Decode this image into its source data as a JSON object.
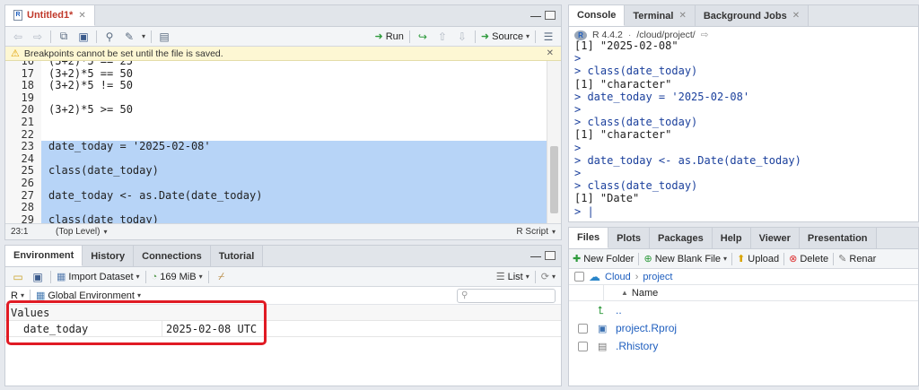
{
  "editor": {
    "tab_title": "Untitled1*",
    "toolbar": {
      "run_label": "Run",
      "source_label": "Source"
    },
    "warning": "Breakpoints cannot be set until the file is saved.",
    "lines": [
      {
        "num": "16",
        "code": "(3+2)*5 == 25",
        "highlight": false
      },
      {
        "num": "17",
        "code": "(3+2)*5 == 50",
        "highlight": false
      },
      {
        "num": "18",
        "code": "(3+2)*5 != 50",
        "highlight": false
      },
      {
        "num": "19",
        "code": "",
        "highlight": false
      },
      {
        "num": "20",
        "code": "(3+2)*5 >= 50",
        "highlight": false
      },
      {
        "num": "21",
        "code": "",
        "highlight": false
      },
      {
        "num": "22",
        "code": "",
        "highlight": false
      },
      {
        "num": "23",
        "code": "date_today = '2025-02-08'",
        "highlight": true
      },
      {
        "num": "24",
        "code": "",
        "highlight": true
      },
      {
        "num": "25",
        "code": "class(date_today)",
        "highlight": true
      },
      {
        "num": "26",
        "code": "",
        "highlight": true
      },
      {
        "num": "27",
        "code": "date_today <- as.Date(date_today)",
        "highlight": true
      },
      {
        "num": "28",
        "code": "",
        "highlight": true
      },
      {
        "num": "29",
        "code": "class(date_today)",
        "highlight": true
      }
    ],
    "status": {
      "position": "23:1",
      "scope": "(Top Level)",
      "filetype": "R Script"
    }
  },
  "env": {
    "tabs": [
      "Environment",
      "History",
      "Connections",
      "Tutorial"
    ],
    "import_label": "Import Dataset",
    "memory": "169 MiB",
    "list_label": "List",
    "lang": "R",
    "scope": "Global Environment",
    "section": "Values",
    "rows": [
      {
        "name": "date_today",
        "value": "2025-02-08 UTC"
      }
    ]
  },
  "console": {
    "tabs": [
      "Console",
      "Terminal",
      "Background Jobs"
    ],
    "version": "R 4.4.2",
    "path": "/cloud/project/",
    "lines": [
      {
        "type": "out",
        "text": "[1] \"2025-02-08\""
      },
      {
        "type": "prompt",
        "text": ">"
      },
      {
        "type": "cmd",
        "text": "> class(date_today)"
      },
      {
        "type": "out",
        "text": "[1] \"character\""
      },
      {
        "type": "cmd",
        "text": "> date_today = '2025-02-08'"
      },
      {
        "type": "prompt",
        "text": ">"
      },
      {
        "type": "cmd",
        "text": "> class(date_today)"
      },
      {
        "type": "out",
        "text": "[1] \"character\""
      },
      {
        "type": "prompt",
        "text": ">"
      },
      {
        "type": "cmd",
        "text": "> date_today <- as.Date(date_today)"
      },
      {
        "type": "prompt",
        "text": ">"
      },
      {
        "type": "cmd",
        "text": "> class(date_today)"
      },
      {
        "type": "out",
        "text": "[1] \"Date\""
      },
      {
        "type": "prompt",
        "text": "> |"
      }
    ]
  },
  "files": {
    "tabs": [
      "Files",
      "Plots",
      "Packages",
      "Help",
      "Viewer",
      "Presentation"
    ],
    "toolbar": {
      "new_folder": "New Folder",
      "new_blank": "New Blank File",
      "upload": "Upload",
      "delete": "Delete",
      "rename": "Renar"
    },
    "breadcrumb": {
      "root": "Cloud",
      "folder": "project"
    },
    "column_name": "Name",
    "up_label": "..",
    "items": [
      "project.Rproj",
      ".Rhistory"
    ]
  },
  "colors": {
    "highlight": "#b7d4f7",
    "link": "#1f5fbf",
    "console_blue": "#1a3f9c",
    "warning_bg": "#fdf7d3",
    "annotation_red": "#e01b24"
  }
}
